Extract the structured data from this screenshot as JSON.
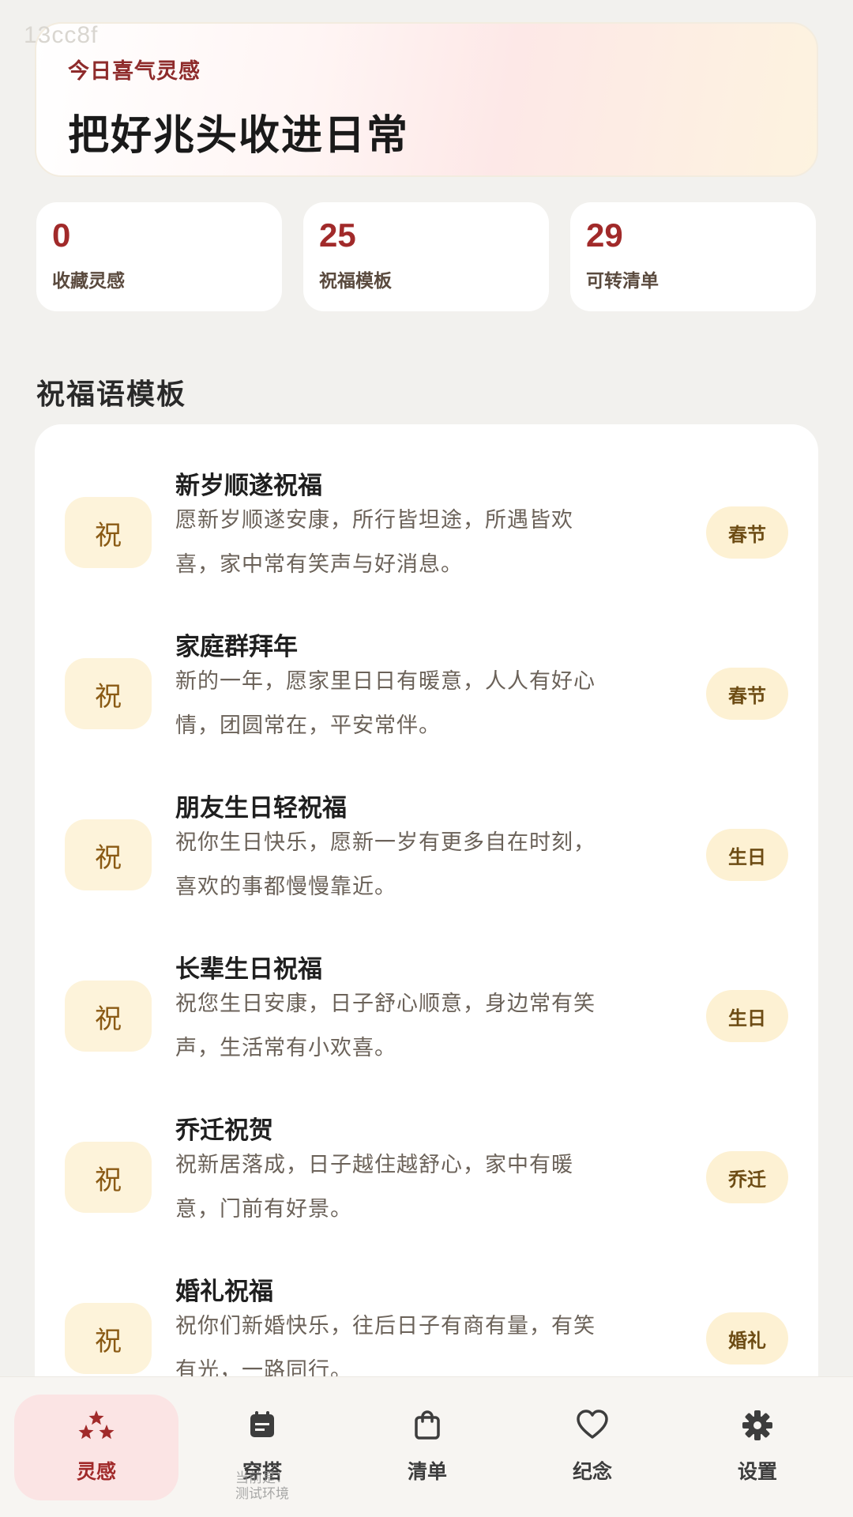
{
  "watermark": "13cc8f",
  "hero": {
    "kicker": "今日喜气灵感",
    "title": "把好兆头收进日常"
  },
  "stats": [
    {
      "value": "0",
      "label": "收藏灵感"
    },
    {
      "value": "25",
      "label": "祝福模板"
    },
    {
      "value": "29",
      "label": "可转清单"
    }
  ],
  "section_title": "祝福语模板",
  "templates": [
    {
      "icon_char": "祝",
      "title": "新岁顺遂祝福",
      "line1": "愿新岁顺遂安康，所行皆坦途，所遇皆欢",
      "line2": "喜，家中常有笑声与好消息。",
      "tag": "春节"
    },
    {
      "icon_char": "祝",
      "title": "家庭群拜年",
      "line1": "新的一年，愿家里日日有暖意，人人有好心",
      "line2": "情，团圆常在，平安常伴。",
      "tag": "春节"
    },
    {
      "icon_char": "祝",
      "title": "朋友生日轻祝福",
      "line1": "祝你生日快乐，愿新一岁有更多自在时刻，",
      "line2": "喜欢的事都慢慢靠近。",
      "tag": "生日"
    },
    {
      "icon_char": "祝",
      "title": "长辈生日祝福",
      "line1": "祝您生日安康，日子舒心顺意，身边常有笑",
      "line2": "声，生活常有小欢喜。",
      "tag": "生日"
    },
    {
      "icon_char": "祝",
      "title": "乔迁祝贺",
      "line1": "祝新居落成，日子越住越舒心，家中有暖",
      "line2": "意，门前有好景。",
      "tag": "乔迁"
    },
    {
      "icon_char": "祝",
      "title": "婚礼祝福",
      "line1": "祝你们新婚快乐，往后日子有商有量，有笑",
      "line2": "有光，一路同行。",
      "tag": "婚礼"
    }
  ],
  "tabs": [
    {
      "label": "灵感",
      "icon": "stars-icon",
      "active": true
    },
    {
      "label": "穿搭",
      "icon": "calendar-icon",
      "overlay_line1": "当前是：",
      "overlay_line2": "测试环境"
    },
    {
      "label": "清单",
      "icon": "bag-icon"
    },
    {
      "label": "纪念",
      "icon": "heart-icon"
    },
    {
      "label": "设置",
      "icon": "gear-icon"
    }
  ],
  "colors": {
    "accent": "#a12a2a",
    "tag_bg": "#fdf1d3",
    "active_tab_bg": "#fbe4e4"
  }
}
